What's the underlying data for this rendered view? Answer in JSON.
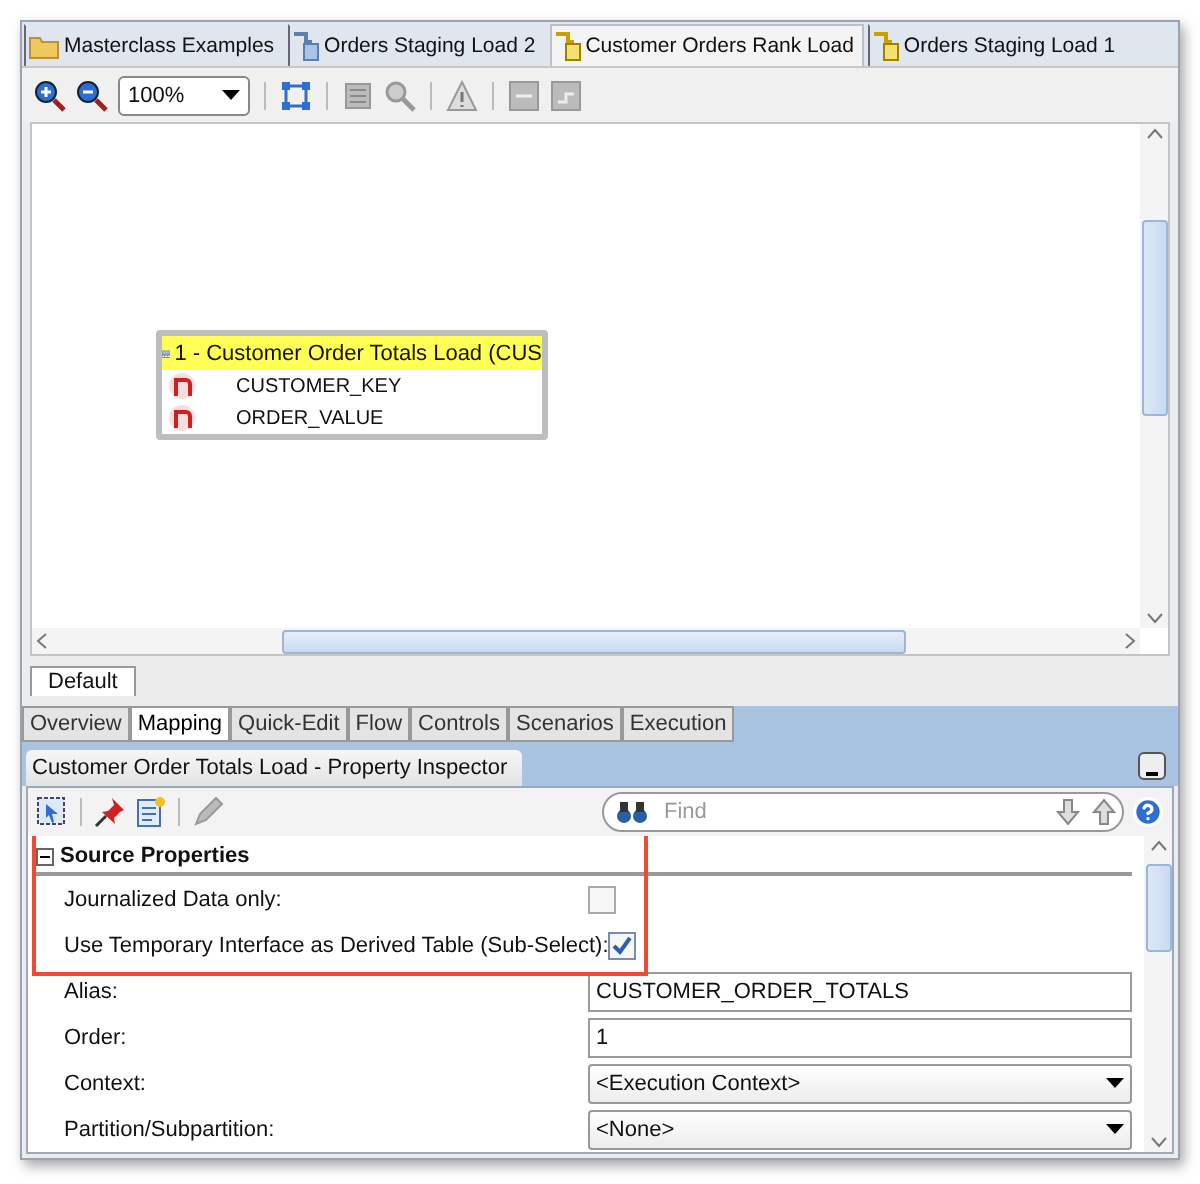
{
  "editor_tabs": [
    {
      "label": "Masterclass Examples",
      "kind": "folder",
      "selected": false
    },
    {
      "label": "Orders Staging Load 2",
      "kind": "interface",
      "selected": false
    },
    {
      "label": "Customer Orders Rank Load",
      "kind": "temporary",
      "selected": true
    },
    {
      "label": "Orders Staging Load 1",
      "kind": "temporary",
      "selected": false
    }
  ],
  "toolbar": {
    "zoom": "100%"
  },
  "diagram": {
    "node": {
      "title": "1 - Customer Order Totals Load (CUS",
      "columns": [
        "CUSTOMER_KEY",
        "ORDER_VALUE"
      ]
    }
  },
  "diagram_tabs": [
    {
      "label": "Default",
      "selected": true
    }
  ],
  "view_tabs": [
    {
      "label": "Overview",
      "selected": false
    },
    {
      "label": "Mapping",
      "selected": true
    },
    {
      "label": "Quick-Edit",
      "selected": false
    },
    {
      "label": "Flow",
      "selected": false
    },
    {
      "label": "Controls",
      "selected": false
    },
    {
      "label": "Scenarios",
      "selected": false
    },
    {
      "label": "Execution",
      "selected": false
    }
  ],
  "inspector": {
    "title": "Customer Order Totals Load - Property Inspector",
    "find": {
      "placeholder": "Find"
    },
    "section": {
      "title": "Source Properties",
      "expanded": true,
      "highlighted": true
    },
    "properties": [
      {
        "kind": "checkbox",
        "label": "Journalized Data only:",
        "checked": false
      },
      {
        "kind": "checkbox",
        "label": "Use Temporary Interface as Derived Table (Sub-Select):",
        "checked": true
      },
      {
        "kind": "text",
        "label": "Alias:",
        "value": "CUSTOMER_ORDER_TOTALS"
      },
      {
        "kind": "text",
        "label": "Order:",
        "value": "1"
      },
      {
        "kind": "select",
        "label": "Context:",
        "value": "<Execution Context>"
      },
      {
        "kind": "select",
        "label": "Partition/Subpartition:",
        "value": "<None>"
      }
    ]
  }
}
